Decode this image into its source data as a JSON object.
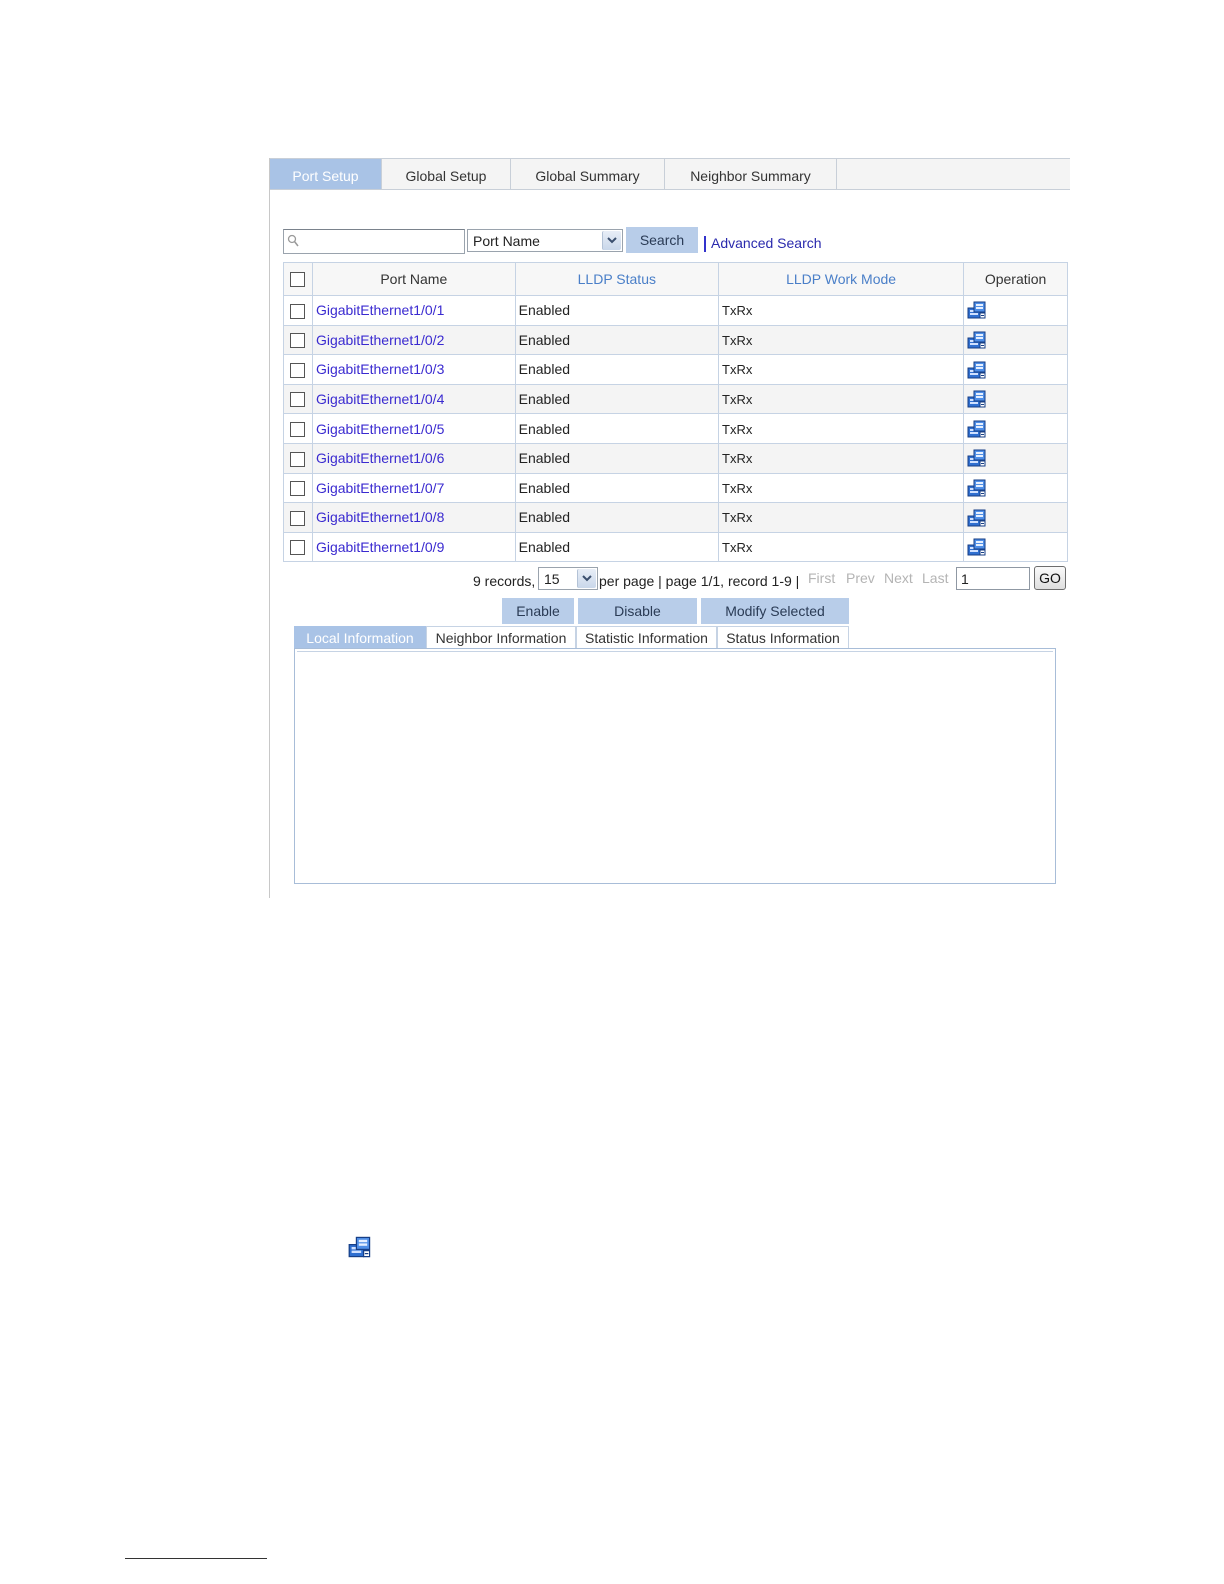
{
  "tabs": [
    {
      "label": "Port Setup",
      "active": true
    },
    {
      "label": "Global Setup",
      "active": false
    },
    {
      "label": "Global Summary",
      "active": false
    },
    {
      "label": "Neighbor Summary",
      "active": false
    }
  ],
  "search": {
    "value": "",
    "field_selected": "Port Name",
    "search_button": "Search",
    "advanced_link": "Advanced Search"
  },
  "grid": {
    "columns": [
      "Port Name",
      "LLDP Status",
      "LLDP Work Mode",
      "Operation"
    ],
    "rows": [
      {
        "port": "GigabitEthernet1/0/1",
        "status": "Enabled",
        "mode": "TxRx"
      },
      {
        "port": "GigabitEthernet1/0/2",
        "status": "Enabled",
        "mode": "TxRx"
      },
      {
        "port": "GigabitEthernet1/0/3",
        "status": "Enabled",
        "mode": "TxRx"
      },
      {
        "port": "GigabitEthernet1/0/4",
        "status": "Enabled",
        "mode": "TxRx"
      },
      {
        "port": "GigabitEthernet1/0/5",
        "status": "Enabled",
        "mode": "TxRx"
      },
      {
        "port": "GigabitEthernet1/0/6",
        "status": "Enabled",
        "mode": "TxRx"
      },
      {
        "port": "GigabitEthernet1/0/7",
        "status": "Enabled",
        "mode": "TxRx"
      },
      {
        "port": "GigabitEthernet1/0/8",
        "status": "Enabled",
        "mode": "TxRx"
      },
      {
        "port": "GigabitEthernet1/0/9",
        "status": "Enabled",
        "mode": "TxRx"
      }
    ],
    "operation_icon": "modify-icon"
  },
  "pager": {
    "records": "9 records,",
    "per_page_value": "15",
    "summary": "per page | page 1/1, record 1-9 |",
    "first": "First",
    "prev": "Prev",
    "next": "Next",
    "last": "Last",
    "page_value": "1",
    "go": "GO"
  },
  "actions": {
    "enable": "Enable",
    "disable": "Disable",
    "modify_selected": "Modify Selected"
  },
  "info_tabs": [
    {
      "label": "Local Information",
      "active": true
    },
    {
      "label": "Neighbor Information",
      "active": false
    },
    {
      "label": "Statistic Information",
      "active": false
    },
    {
      "label": "Status Information",
      "active": false
    }
  ],
  "colors": {
    "tab_active": "#a9c3e6",
    "link": "#3a2ad0",
    "sortable_header": "#4a7fc8",
    "button": "#b8cde9"
  }
}
